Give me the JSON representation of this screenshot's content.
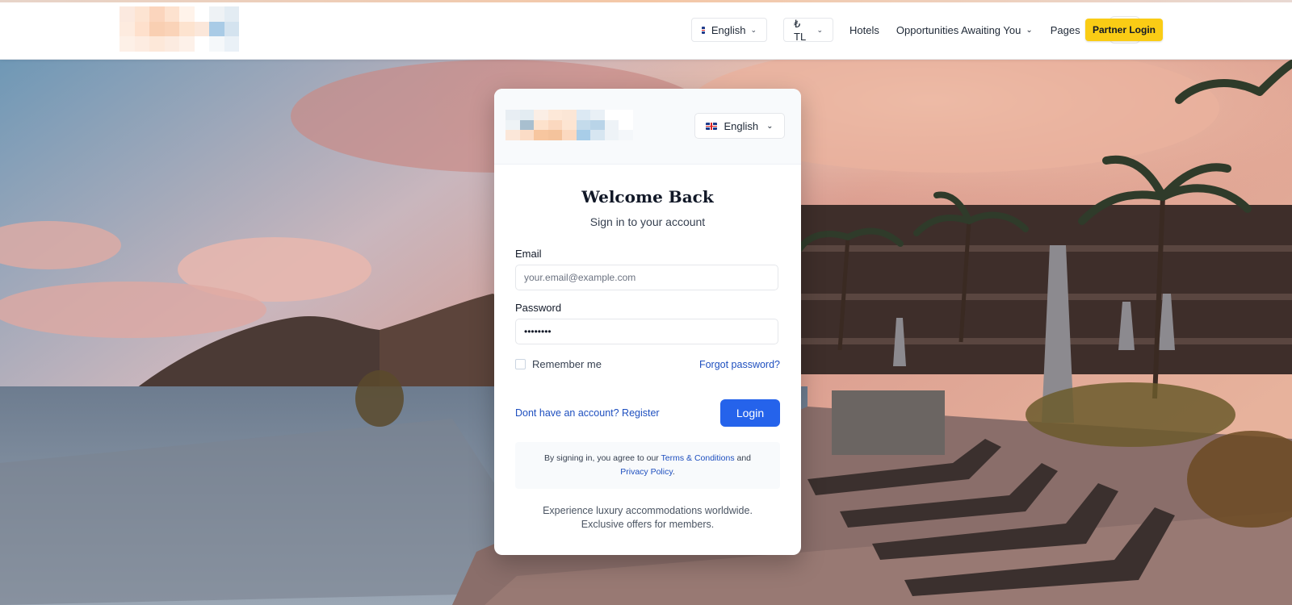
{
  "nav": {
    "language": "English",
    "currency": "₺ TL",
    "hotels": "Hotels",
    "opportunities": "Opportunities Awaiting You",
    "pages": "Pages",
    "partner_login": "Partner Login"
  },
  "login": {
    "language": "English",
    "title": "Welcome Back",
    "subtitle": "Sign in to your account",
    "email_label": "Email",
    "email_placeholder": "your.email@example.com",
    "password_label": "Password",
    "password_value": "••••••••",
    "remember": "Remember me",
    "forgot": "Forgot password?",
    "register": "Dont have an account? Register",
    "login_button": "Login",
    "terms_prefix": "By signing in, you agree to our",
    "terms_link": "Terms & Conditions",
    "terms_and": "and",
    "privacy_link": "Privacy Policy",
    "terms_suffix": ".",
    "tagline": "Experience luxury accommodations worldwide. Exclusive offers for members."
  },
  "colors": {
    "accent": "#2563eb",
    "partner": "#facc15",
    "link": "#1e4fbf"
  },
  "icons": {
    "user": "user-icon",
    "chevron": "chevron-down-icon",
    "flag": "uk-flag-icon"
  }
}
